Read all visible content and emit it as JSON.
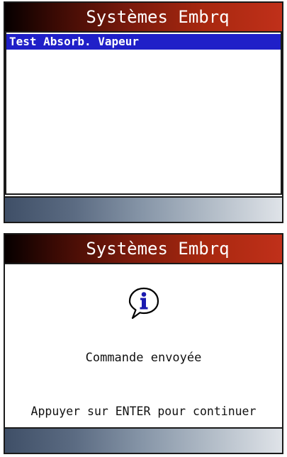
{
  "screen1": {
    "title": "Systèmes Embrq",
    "items": [
      {
        "label": "Test Absorb. Vapeur",
        "selected": true
      }
    ]
  },
  "screen2": {
    "title": "Systèmes Embrq",
    "icon": "info-icon",
    "message": "Commande envoyée",
    "instruction": "Appuyer sur ENTER pour continuer"
  },
  "colors": {
    "title_bar_dark": "#060000",
    "title_bar_light": "#c0301a",
    "selection": "#2020c8",
    "status_bar_dark": "#3f4f67",
    "status_bar_light": "#dfe3e8",
    "info_icon": "#1a1ab0"
  }
}
